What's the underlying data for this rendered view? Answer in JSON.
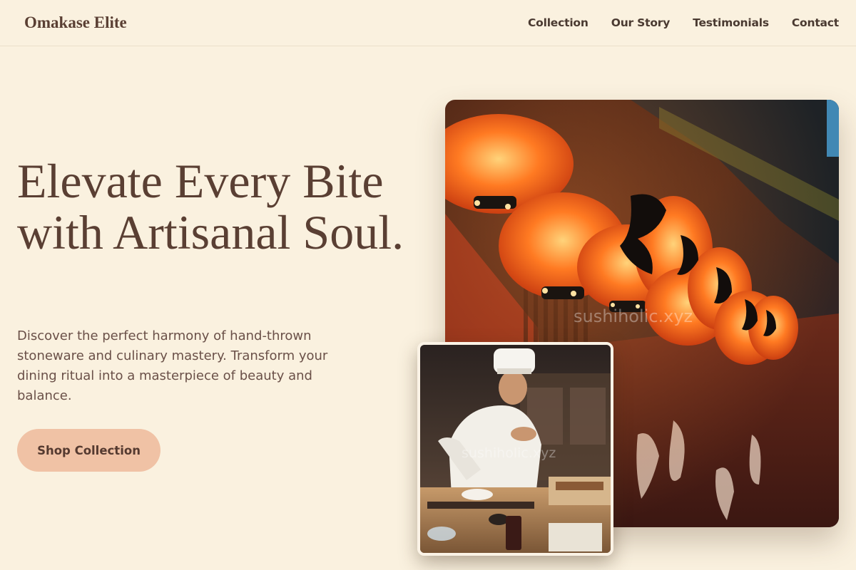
{
  "header": {
    "brand": "Omakase Elite",
    "nav": [
      "Collection",
      "Our Story",
      "Testimonials",
      "Contact"
    ]
  },
  "hero": {
    "title": "Elevate Every Bite with Artisanal Soul.",
    "description": "Discover the perfect harmony of hand-thrown stoneware and culinary mastery. Transform your dining ritual into a masterpiece of beauty and balance.",
    "cta_label": "Shop Collection"
  },
  "images": {
    "main": {
      "depicts": "red paper lanterns hanging above a Japanese street restaurant at night",
      "watermark": "sushiholic.xyz"
    },
    "secondary": {
      "depicts": "sushi chef in white uniform preparing food at a counter",
      "watermark": "sushiholic.xyz"
    }
  },
  "colors": {
    "background": "#faf1df",
    "text": "#5a3f33",
    "cta_background": "#f0c2a5"
  }
}
